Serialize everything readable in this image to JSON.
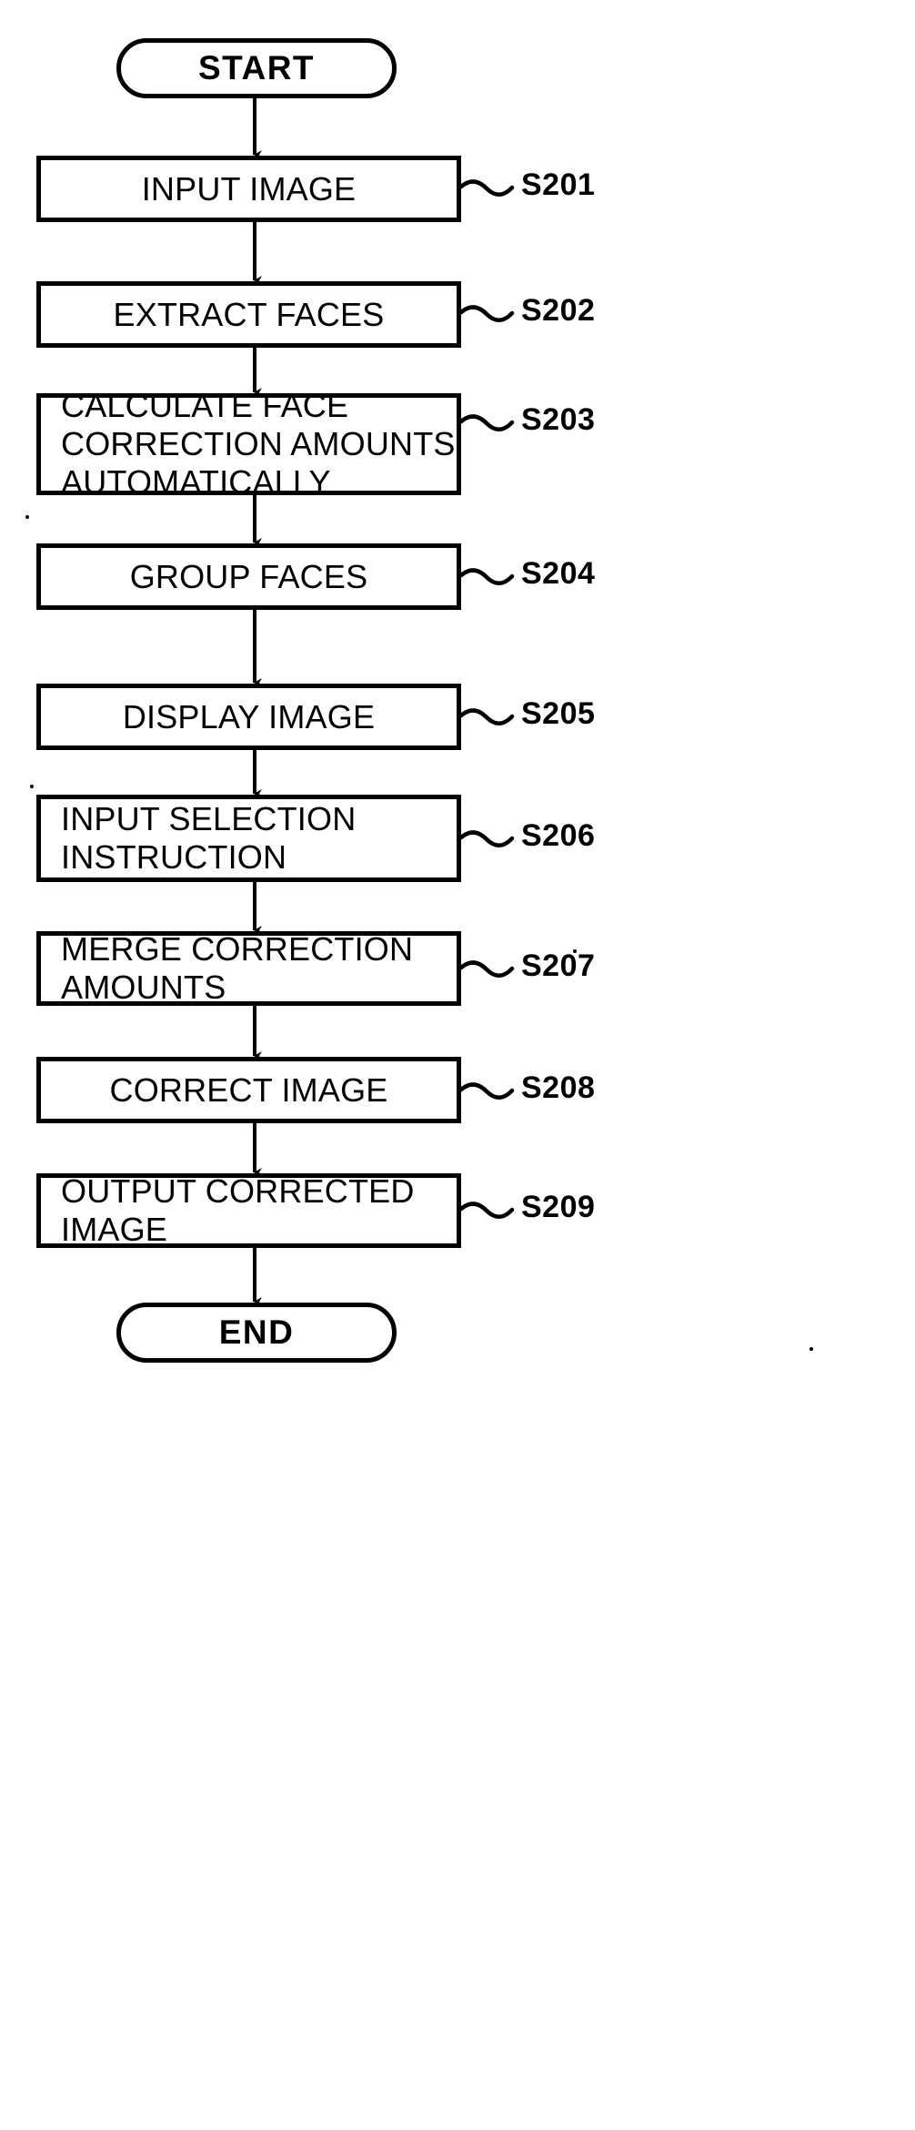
{
  "figure": {
    "type": "flowchart",
    "orientation": "vertical",
    "style": "patent-drawing",
    "colors": {
      "ink": "#000000",
      "paper": "#ffffff"
    },
    "start": {
      "label": "START",
      "shape": "terminator"
    },
    "end": {
      "label": "END",
      "shape": "terminator"
    },
    "steps": [
      {
        "ref": "S201",
        "text": "INPUT IMAGE",
        "lines": [
          "INPUT IMAGE"
        ],
        "align": "center"
      },
      {
        "ref": "S202",
        "text": "EXTRACT FACES",
        "lines": [
          "EXTRACT FACES"
        ],
        "align": "center"
      },
      {
        "ref": "S203",
        "text": "CALCULATE FACE\nCORRECTION AMOUNTS\nAUTOMATICALLY",
        "lines": [
          "CALCULATE FACE",
          "CORRECTION AMOUNTS",
          "AUTOMATICALLY"
        ],
        "align": "left"
      },
      {
        "ref": "S204",
        "text": "GROUP FACES",
        "lines": [
          "GROUP FACES"
        ],
        "align": "center"
      },
      {
        "ref": "S205",
        "text": "DISPLAY IMAGE",
        "lines": [
          "DISPLAY IMAGE"
        ],
        "align": "center"
      },
      {
        "ref": "S206",
        "text": "INPUT SELECTION\nINSTRUCTION",
        "lines": [
          "INPUT SELECTION",
          "INSTRUCTION"
        ],
        "align": "left"
      },
      {
        "ref": "S207",
        "text": "MERGE CORRECTION\nAMOUNTS",
        "lines": [
          "MERGE CORRECTION",
          "AMOUNTS"
        ],
        "align": "left"
      },
      {
        "ref": "S208",
        "text": "CORRECT IMAGE",
        "lines": [
          "CORRECT IMAGE"
        ],
        "align": "center"
      },
      {
        "ref": "S209",
        "text": "OUTPUT CORRECTED\nIMAGE",
        "lines": [
          "OUTPUT CORRECTED",
          "IMAGE"
        ],
        "align": "left"
      }
    ]
  }
}
